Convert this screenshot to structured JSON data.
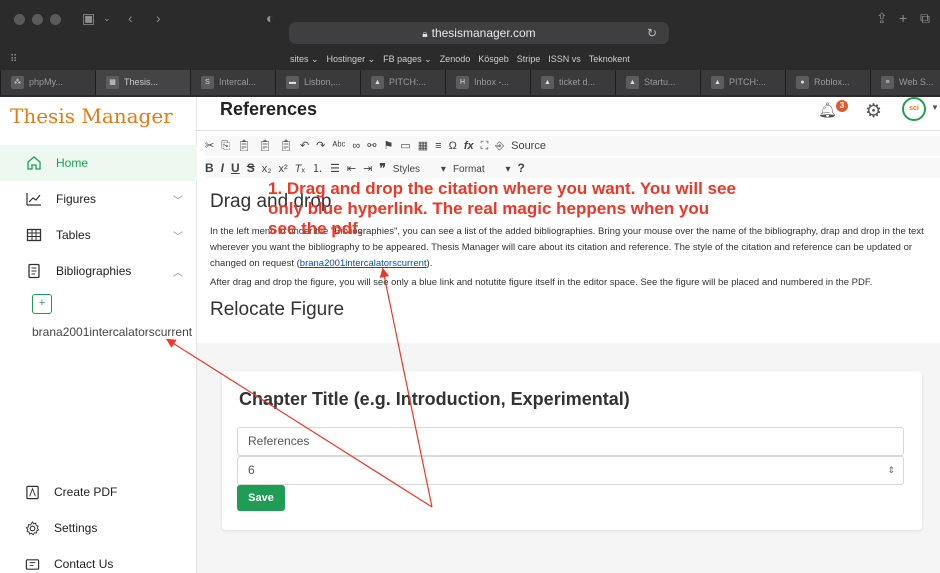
{
  "browser": {
    "url": "thesismanager.com",
    "favorites": [
      "sites ⌄",
      "Hostinger ⌄",
      "FB pages ⌄",
      "Zenodo",
      "Kösgeb",
      "Stripe",
      "ISSN vs",
      "Teknokent"
    ],
    "tabs": [
      {
        "label": "phpMy..."
      },
      {
        "label": "Thesis..."
      },
      {
        "label": "Intercal..."
      },
      {
        "label": "Lisbon,..."
      },
      {
        "label": "PITCH:..."
      },
      {
        "label": "Inbox -..."
      },
      {
        "label": "ticket d..."
      },
      {
        "label": "Startu..."
      },
      {
        "label": "PITCH:..."
      },
      {
        "label": "Roblox..."
      },
      {
        "label": "Web S..."
      }
    ]
  },
  "sidebar": {
    "brand": "Thesis Manager",
    "items": [
      {
        "label": "Home",
        "icon": "home-icon"
      },
      {
        "label": "Figures",
        "icon": "chart-line-icon"
      },
      {
        "label": "Tables",
        "icon": "table-icon"
      },
      {
        "label": "Bibliographies",
        "icon": "document-icon"
      }
    ],
    "bibliography_item": "brana2001intercalatorscurrent",
    "bottom": [
      {
        "label": "Create PDF",
        "icon": "pdf-icon"
      },
      {
        "label": "Settings",
        "icon": "settings-icon"
      },
      {
        "label": "Contact Us",
        "icon": "contact-icon"
      }
    ]
  },
  "header": {
    "title": "References",
    "notification_count": "3",
    "avatar_text": "sci"
  },
  "editor": {
    "toolbar": {
      "source": "Source",
      "styles": "Styles",
      "format": "Format"
    },
    "heading1": "Drag and drop",
    "paragraph": "In the left menu in under the \"Bibliographies\", you can see a list of the added bibliographies. Bring your mouse over the name of the bibliography, drap and drop in the text wherever you want the bibliography to be appeared. Thesis Manager will care about its citation and reference. The style of the citation and reference can be updated or changed on request (",
    "citation_link": "brana2001intercalatorscurrent",
    "paragraph_end": ").",
    "paragraph2": "After drag and drop the figure, you will see only a blue link and notutite figure itself in the editor space. See the figure will be placed and numbered in the PDF.",
    "heading2": "Relocate Figure"
  },
  "annotation": "1. Drag and drop the citation where you want. You will see only blue hyperlink. The real magic heppens when you see the pdf.",
  "form": {
    "title": "Chapter Title (e.g. Introduction, Experimental)",
    "title_value": "References",
    "number_value": "6",
    "save_label": "Save"
  },
  "colors": {
    "accent": "#1e9e55",
    "brand": "#e07b1a",
    "annotation": "#e8392a"
  }
}
